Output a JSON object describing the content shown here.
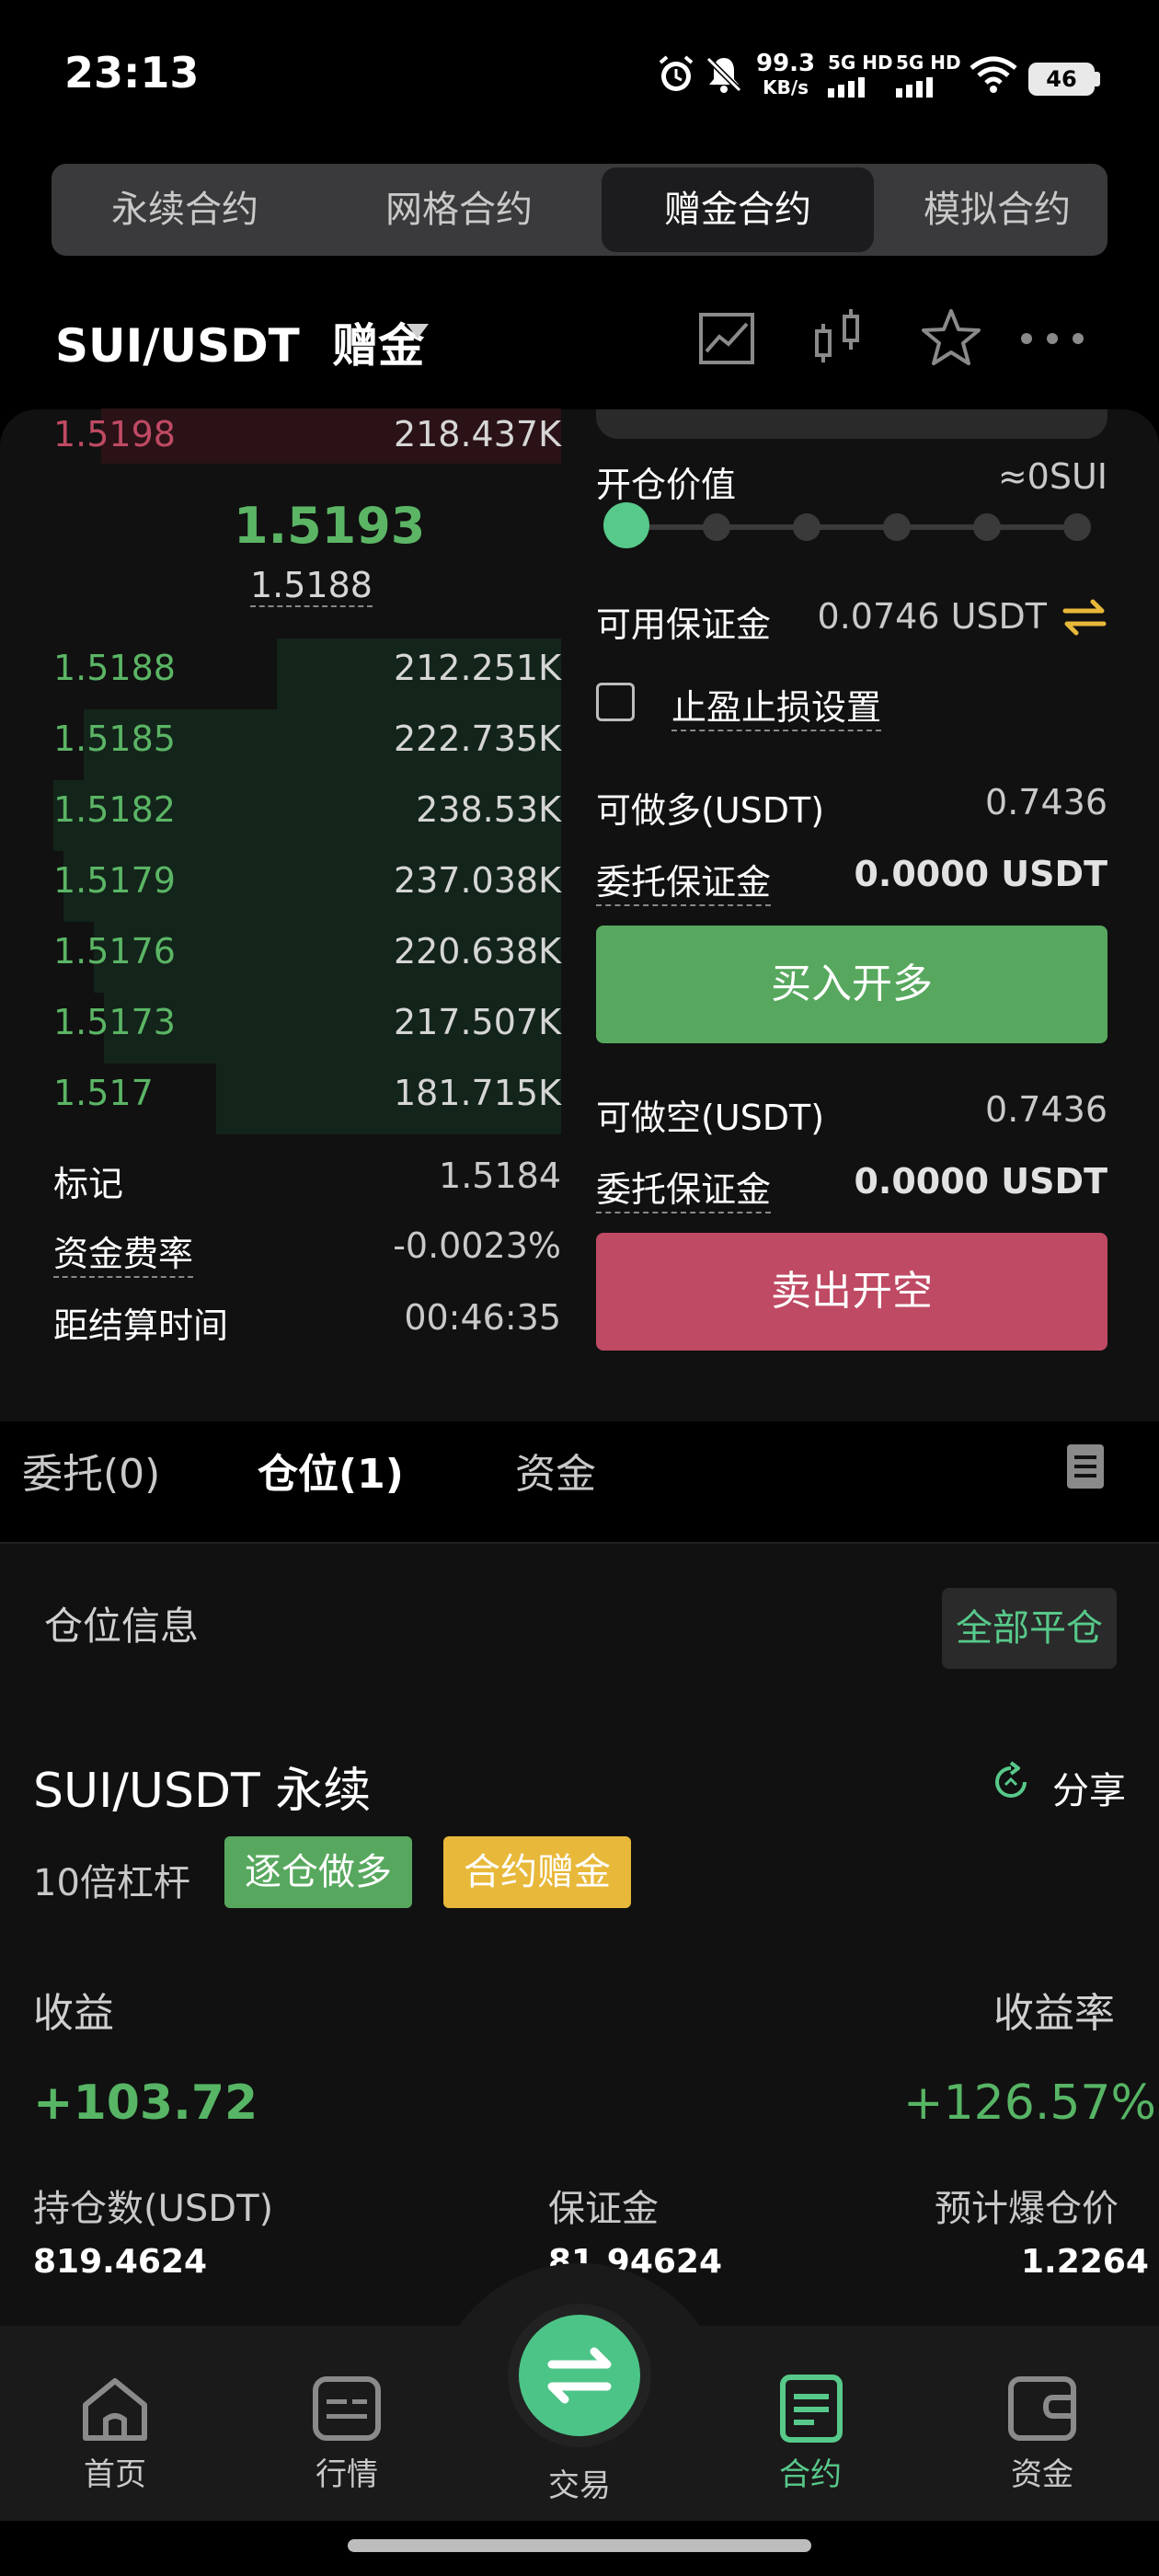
{
  "status_bar": {
    "time": "23:13",
    "net_speed_value": "99.3",
    "net_speed_unit": "KB/s",
    "sim1_label": "5G HD",
    "sim2_label": "5G HD",
    "battery": "46",
    "icons": [
      "alarm-icon",
      "mute-icon",
      "wifi-icon"
    ]
  },
  "contract_tabs": [
    {
      "label": "永续合约",
      "active": false
    },
    {
      "label": "网格合约",
      "active": false
    },
    {
      "label": "赠金合约",
      "active": true
    },
    {
      "label": "模拟合约",
      "active": false
    }
  ],
  "header": {
    "pair": "SUI/USDT",
    "mode": "赠金",
    "icons": [
      "chart-icon",
      "candlestick-icon",
      "star-icon",
      "more-icon"
    ]
  },
  "order_book": {
    "ask_row": {
      "price": "1.5198",
      "qty": "218.437K"
    },
    "last_price": "1.5193",
    "index_price": "1.5188",
    "bids": [
      {
        "price": "1.5188",
        "qty": "212.251K",
        "depth": 0.56
      },
      {
        "price": "1.5185",
        "qty": "222.735K",
        "depth": 0.94
      },
      {
        "price": "1.5182",
        "qty": "238.53K",
        "depth": 1.0
      },
      {
        "price": "1.5179",
        "qty": "237.038K",
        "depth": 0.98
      },
      {
        "price": "1.5176",
        "qty": "220.638K",
        "depth": 0.92
      },
      {
        "price": "1.5173",
        "qty": "217.507K",
        "depth": 0.9
      },
      {
        "price": "1.517",
        "qty": "181.715K",
        "depth": 0.68
      }
    ]
  },
  "market_info": {
    "mark_label": "标记",
    "mark_value": "1.5184",
    "funding_label": "资金费率",
    "funding_value": "-0.0023%",
    "settle_label": "距结算时间",
    "settle_value": "00:46:35"
  },
  "form": {
    "open_value_label": "开仓价值",
    "open_value": "≈0SUI",
    "slider_percent": 0,
    "available_margin_label": "可用保证金",
    "available_margin": "0.0746 USDT",
    "tp_sl_label": "止盈止损设置",
    "tp_sl_checked": false,
    "long_max_label": "可做多(USDT)",
    "long_max": "0.7436",
    "long_margin_label": "委托保证金",
    "long_margin": "0.0000 USDT",
    "buy_button": "买入开多",
    "short_max_label": "可做空(USDT)",
    "short_max": "0.7436",
    "short_margin_label": "委托保证金",
    "short_margin": "0.0000 USDT",
    "sell_button": "卖出开空"
  },
  "order_tabs": [
    {
      "label": "委托(0)",
      "active": false
    },
    {
      "label": "仓位(1)",
      "active": true
    },
    {
      "label": "资金",
      "active": false
    }
  ],
  "position": {
    "section_title": "仓位信息",
    "close_all": "全部平仓",
    "symbol": "SUI/USDT 永续",
    "share": "分享",
    "leverage": "10倍杠杆",
    "tag_margin_mode": "逐仓做多",
    "tag_bonus": "合约赠金",
    "pnl_label": "收益",
    "pnl_value": "+103.72",
    "roe_label": "收益率",
    "roe_value": "+126.57%",
    "size_label": "持仓数(USDT)",
    "size_value": "819.4624",
    "margin_label": "保证金",
    "margin_value": "81.94624",
    "liq_label": "预计爆仓价",
    "liq_value": "1.2264"
  },
  "bottom_nav": [
    {
      "label": "首页",
      "icon": "home-icon",
      "active": false
    },
    {
      "label": "行情",
      "icon": "market-icon",
      "active": false
    },
    {
      "label": "交易",
      "icon": "swap-icon",
      "active": false
    },
    {
      "label": "合约",
      "icon": "contract-icon",
      "active": true
    },
    {
      "label": "资金",
      "icon": "wallet-icon",
      "active": false
    }
  ],
  "colors": {
    "green": "#57a85e",
    "red": "#bf4a64",
    "accent": "#57c98a",
    "bonus_tag": "#e8b83a"
  }
}
